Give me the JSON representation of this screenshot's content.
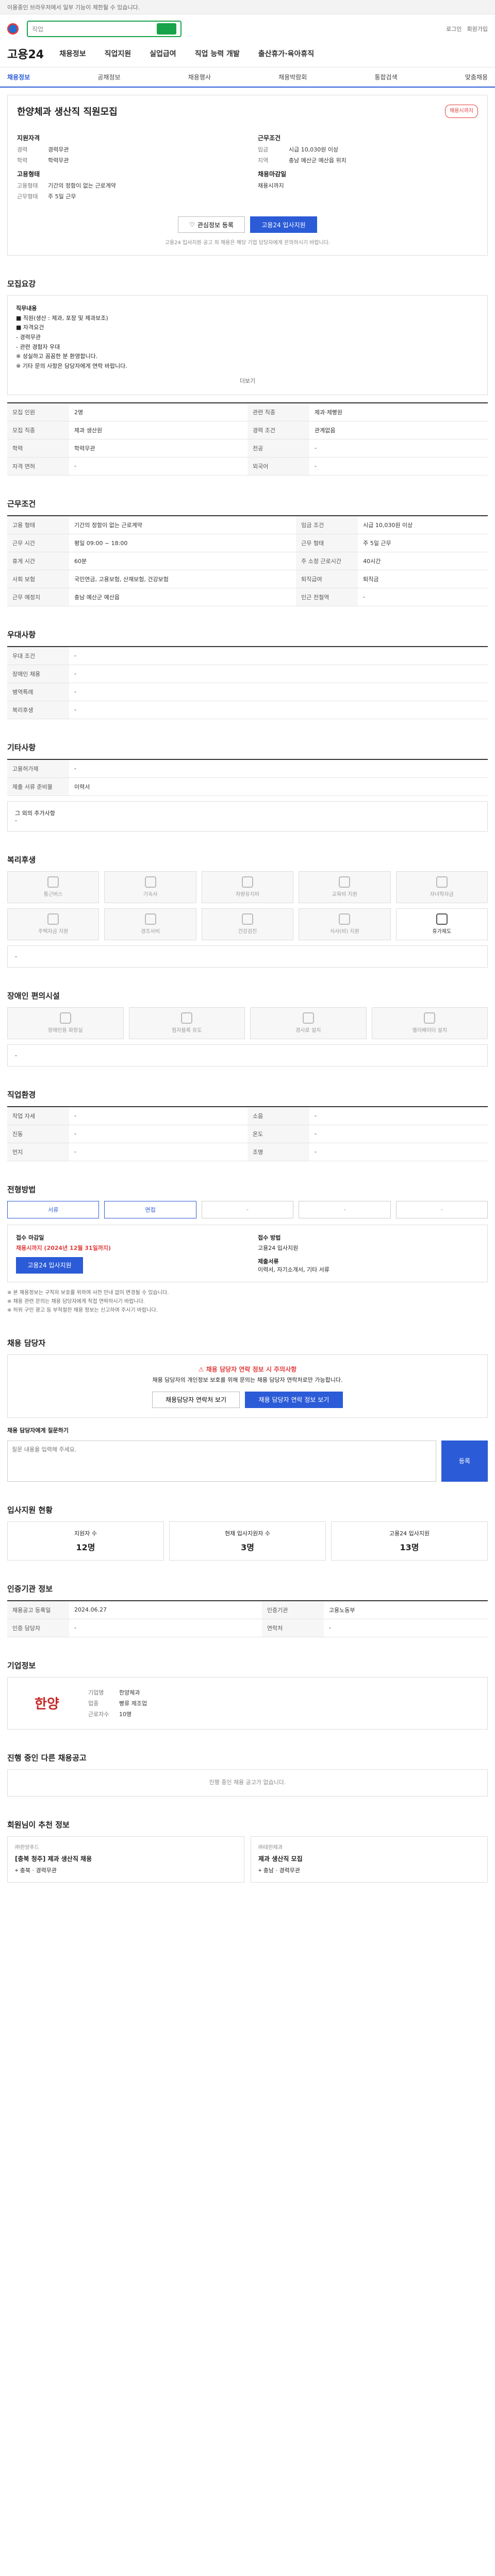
{
  "topbar": {
    "notice": "이용중인 브라우저에서 일부 기능이 제한될 수 있습니다."
  },
  "header": {
    "search_placeholder": "직업",
    "util": [
      "로그인",
      "회원가입"
    ],
    "brand": "고용24",
    "gnb": [
      "채용정보",
      "직업지원",
      "실업급여",
      "직업 능력 개발",
      "출산휴가·육아휴직"
    ]
  },
  "subnav": [
    "채용정보",
    "공채정보",
    "채용행사",
    "채용박람회",
    "통합검색",
    "맞춤채용"
  ],
  "job": {
    "title": "한양체과 생산직 직원모집",
    "badge": "채용시까지",
    "left_title": "지원자격",
    "left": [
      {
        "k": "경력",
        "v": "경력무관"
      },
      {
        "k": "학력",
        "v": "학력무관"
      }
    ],
    "left2_title": "고용형태",
    "left2": [
      {
        "k": "고용형태",
        "v": "기간의 정함이 없는 근로계약"
      },
      {
        "k": "근무형태",
        "v": "주 5일 근무"
      }
    ],
    "right_title": "근무조건",
    "right": [
      {
        "k": "임금",
        "v": "시급 10,030원 이상"
      },
      {
        "k": "지역",
        "v": "충남 예산군 예산읍 위치"
      }
    ],
    "right2_title": "채용마감일",
    "right2": [
      {
        "k": "",
        "v": "채용시까지"
      }
    ],
    "btn_scrap": "관심정보 등록",
    "btn_apply": "고용24 입사지원",
    "note": "고용24 입사지원 공고 외 채용은 해당 기업 담당자에게 문의하시기 바랍니다."
  },
  "recruit": {
    "title": "모집요강",
    "body": [
      "직무내용",
      "■ 직원(생산 : 제과, 포장 및 제과보조)",
      "■ 자격요건",
      "  - 경력무관",
      "  - 관련 경험자 우대",
      "※ 성실하고 꼼꼼한 분 환영합니다.",
      "※ 기타 문의 사항은 담당자에게 연락 바랍니다."
    ],
    "more": "더보기",
    "rows": [
      {
        "k": "모집 인원",
        "v": "2명",
        "k2": "관련 직종",
        "v2": "제과·제빵원"
      },
      {
        "k": "모집 직종",
        "v": "제과 생산원",
        "k2": "경력 조건",
        "v2": "관계없음"
      },
      {
        "k": "학력",
        "v": "학력무관",
        "k2": "전공",
        "v2": "-"
      },
      {
        "k": "자격 면허",
        "v": "-",
        "k2": "외국어",
        "v2": "-"
      }
    ]
  },
  "cond": {
    "title": "근무조건",
    "rows": [
      {
        "k": "고용 형태",
        "v": "기간의 정함이 없는 근로계약",
        "k2": "임금 조건",
        "v2": "시급 10,030원 이상"
      },
      {
        "k": "근무 시간",
        "v": "평일 09:00 ~ 18:00",
        "k2": "근무 형태",
        "v2": "주 5일 근무"
      },
      {
        "k": "휴게 시간",
        "v": "60분",
        "k2": "주 소정 근로시간",
        "v2": "40시간"
      },
      {
        "k": "사회 보험",
        "v": "국민연금, 고용보험, 산재보험, 건강보험",
        "k2": "퇴직급여",
        "v2": "퇴직금"
      },
      {
        "k": "근무 예정지",
        "v": "충남 예산군 예산읍",
        "k2": "인근 전철역",
        "v2": "-"
      }
    ]
  },
  "welfare": {
    "title": "우대사항",
    "rows": [
      {
        "k": "우대 조건",
        "v": "-"
      },
      {
        "k": "장애인 채용",
        "v": "-"
      },
      {
        "k": "병역특례",
        "v": "-"
      },
      {
        "k": "복리후생",
        "v": "-"
      }
    ]
  },
  "etc": {
    "title": "기타사항",
    "rows": [
      {
        "k": "고용허가제",
        "v": "-"
      },
      {
        "k": "제출 서류 준비물",
        "v": "이력서"
      }
    ],
    "sub_title": "그 외의 추가사항"
  },
  "benefits": {
    "title": "복리후생",
    "items": [
      "통근버스",
      "기숙사",
      "차량유지비",
      "교육비 지원",
      "자녀학자금",
      "주택자금 지원",
      "경조사비",
      "건강검진",
      "식사(비) 지원",
      "휴가제도"
    ],
    "active": [
      9
    ]
  },
  "disab": {
    "title": "장애인 편의시설",
    "items": [
      "장애인용 화장실",
      "점자블록 유도",
      "경사로 설치",
      "엘리베이터 설치"
    ]
  },
  "job_env": {
    "title": "직업환경",
    "rows": [
      {
        "k": "작업 자세",
        "v": "-",
        "k2": "소음",
        "v2": "-"
      },
      {
        "k": "진동",
        "v": "-",
        "k2": "온도",
        "v2": "-"
      },
      {
        "k": "먼지",
        "v": "-",
        "k2": "조명",
        "v2": "-"
      }
    ]
  },
  "process": {
    "title": "전형방법",
    "steps": [
      "서류",
      "면접",
      "",
      "",
      ""
    ],
    "apply_period_label": "접수 마감일",
    "apply_period": "채용시까지 (2024년 12월 31일까지)",
    "method_label": "접수 방법",
    "method": "고용24 입사지원",
    "docs_label": "제출서류",
    "docs": "이력서, 자기소개서, 기타 서류",
    "notices": [
      "※ 본 채용정보는 구직자 보호를 위하여 사전 안내 없이 변경될 수 있습니다.",
      "※ 채용 관련 문의는 채용 담당자에게 직접 연락하시기 바랍니다.",
      "※ 허위 구인 광고 등 부적절한 채용 정보는 신고하여 주시기 바랍니다."
    ]
  },
  "manager": {
    "title": "채용 담당자",
    "alert_title": "채용 담당자 연락 정보 시 주의사항",
    "alert_body": "채용 담당자의 개인정보 보호를 위해 문의는 채용 담당자 연락처로만 가능합니다.",
    "btn_view": "채용담당자 연락처 보기",
    "btn_qna": "채용 담당자 연락 정보 보기",
    "qna_title": "채용 담당자에게 질문하기",
    "qna_placeholder": "질문 내용을 입력해 주세요.",
    "qna_btn": "등록"
  },
  "stats": {
    "title": "입사지원 현황",
    "items": [
      {
        "k": "지원자 수",
        "v": "12명"
      },
      {
        "k": "현재 입사지원자 수",
        "v": "3명"
      },
      {
        "k": "고용24 입사지원",
        "v": "13명"
      }
    ]
  },
  "agency": {
    "title": "인증기관 정보",
    "rows": [
      {
        "k": "채용공고 등록일",
        "v": "2024.06.27",
        "k2": "인증기관",
        "v2": "고용노동부"
      },
      {
        "k": "인증 담당자",
        "v": "-",
        "k2": "연락처",
        "v2": "-"
      }
    ]
  },
  "company": {
    "title": "기업정보",
    "logo": "한양",
    "rows": [
      {
        "k": "기업명",
        "v": "한양체과"
      },
      {
        "k": "업종",
        "v": "빵류 제조업"
      },
      {
        "k": "근로자수",
        "v": "10명"
      }
    ]
  },
  "others": {
    "title": "진행 중인 다른 채용공고",
    "empty": "진행 중인 채용 공고가 없습니다."
  },
  "recommend": {
    "title": "회원님이 추천 정보",
    "cards": [
      {
        "cname": "㈜한양푸드",
        "title": "[충북 청주] 제과 생산직 채용",
        "region": "충북",
        "career": "경력무관"
      },
      {
        "cname": "㈜대한제과",
        "title": "제과 생산직 모집",
        "region": "충남",
        "career": "경력무관"
      }
    ]
  }
}
